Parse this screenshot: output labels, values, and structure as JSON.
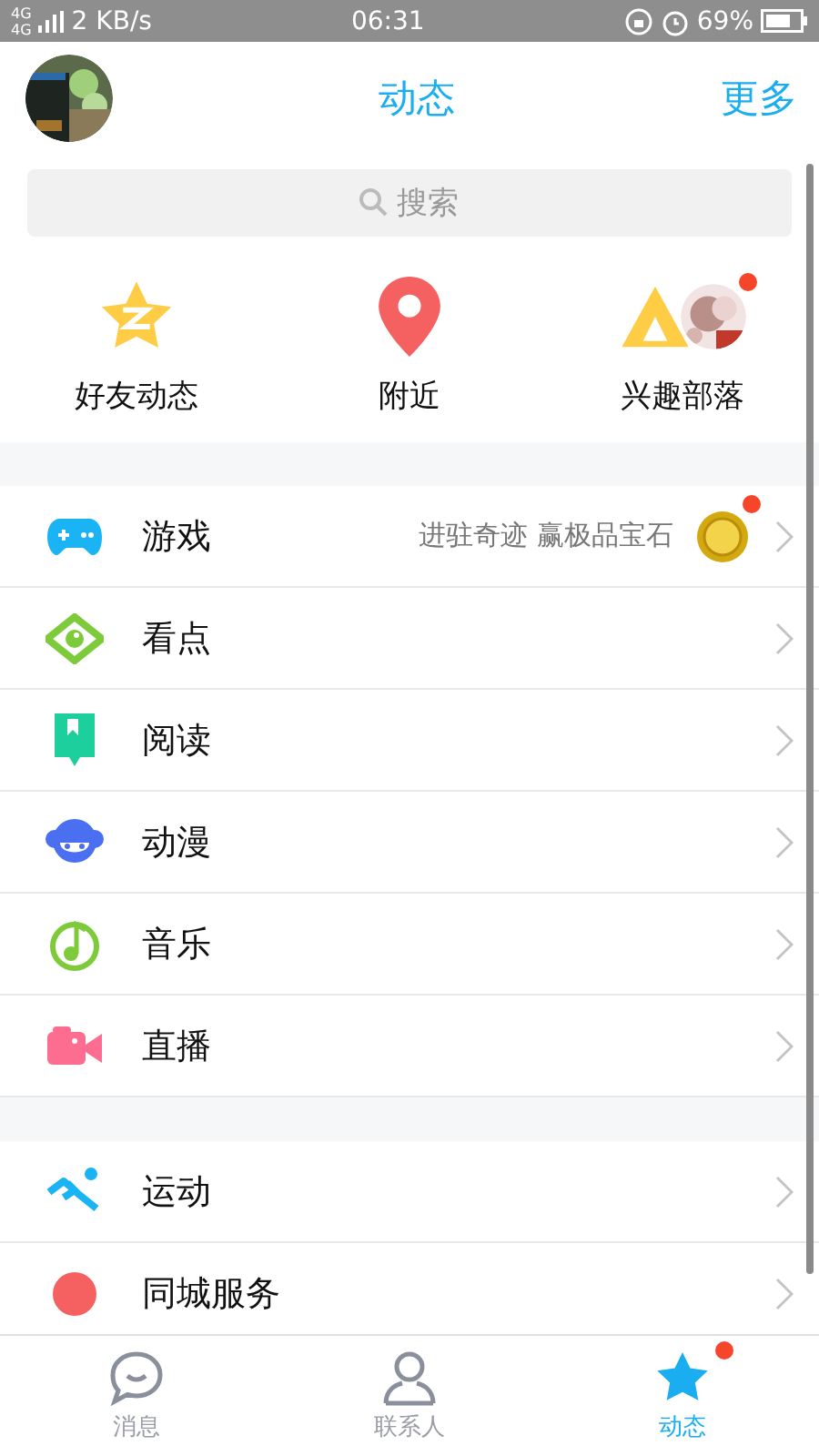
{
  "status_bar": {
    "network": [
      "4G",
      "4G"
    ],
    "speed": "2 KB/s",
    "time": "06:31",
    "battery": "69%"
  },
  "header": {
    "title": "动态",
    "more": "更多"
  },
  "search": {
    "placeholder": "搜索"
  },
  "shortcuts": [
    {
      "label": "好友动态",
      "badge": false
    },
    {
      "label": "附近",
      "badge": false
    },
    {
      "label": "兴趣部落",
      "badge": true
    }
  ],
  "groups": [
    [
      {
        "label": "游戏",
        "promo": "进驻奇迹 赢极品宝石",
        "badge": true
      },
      {
        "label": "看点",
        "badge": false
      },
      {
        "label": "阅读",
        "badge": false
      },
      {
        "label": "动漫",
        "badge": false
      },
      {
        "label": "音乐",
        "badge": false
      },
      {
        "label": "直播",
        "badge": false
      }
    ],
    [
      {
        "label": "运动",
        "badge": false
      },
      {
        "label": "同城服务",
        "badge": false
      }
    ]
  ],
  "tabs": [
    {
      "label": "消息",
      "selected": false,
      "badge": false
    },
    {
      "label": "联系人",
      "selected": false,
      "badge": false
    },
    {
      "label": "动态",
      "selected": true,
      "badge": true
    }
  ]
}
